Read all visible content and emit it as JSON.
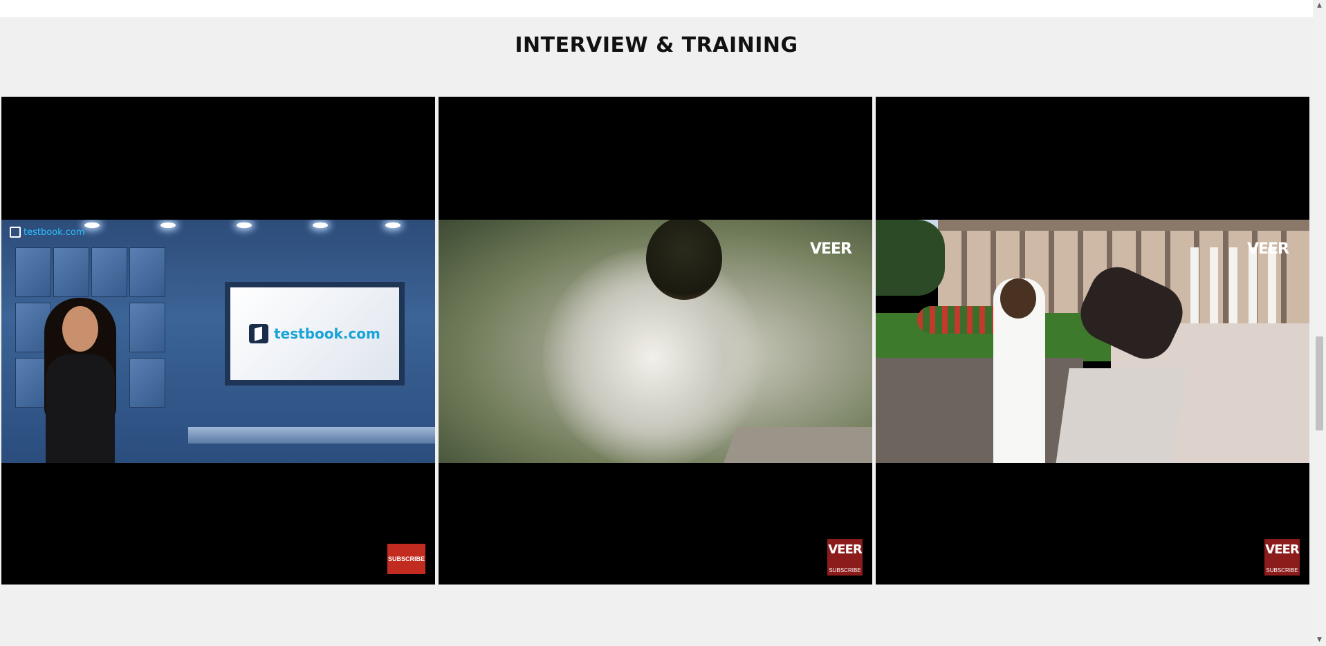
{
  "section": {
    "title": "INTERVIEW & TRAINING"
  },
  "videos": [
    {
      "watermark": "testbook.com",
      "screen_logo": "testbook.com",
      "corner_badge": "SUBSCRIBE"
    },
    {
      "watermark": "VEER",
      "corner_badge_logo": "VEER",
      "corner_badge_text": "SUBSCRIBE"
    },
    {
      "watermark": "VEER",
      "corner_badge_logo": "VEER",
      "corner_badge_text": "SUBSCRIBE"
    }
  ],
  "scrollbar": {
    "up_arrow": "▲",
    "down_arrow": "▼"
  },
  "colors": {
    "page_bg": "#f0f0f0",
    "subscribe_red": "#c22b1f",
    "testbook_blue": "#1aa3d6"
  }
}
